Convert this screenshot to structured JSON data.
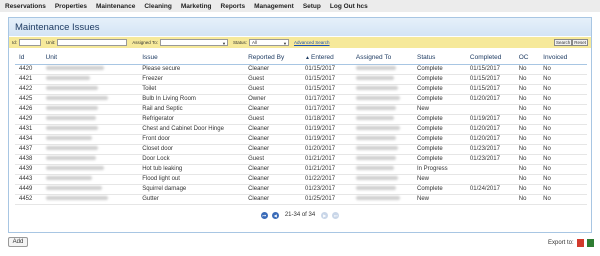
{
  "nav": [
    "Reservations",
    "Properties",
    "Maintenance",
    "Cleaning",
    "Marketing",
    "Reports",
    "Management",
    "Setup",
    "Log Out hcs"
  ],
  "panel": {
    "title": "Maintenance Issues"
  },
  "filters": {
    "id_label": "Id:",
    "unit_label": "Unit:",
    "assigned_label": "Assigned To:",
    "status_label": "Status:",
    "status_value": "All",
    "advanced_link": "Advanced Search",
    "search_btn": "Search",
    "reset_btn": "Reset"
  },
  "table": {
    "headers": [
      "Id",
      "Unit",
      "Issue",
      "Reported By",
      "Entered",
      "Assigned To",
      "Status",
      "Completed",
      "OC",
      "Invoiced"
    ],
    "rows": [
      {
        "id": "4420",
        "issue": "Please secure",
        "reported": "Cleaner",
        "entered": "01/15/2017",
        "status": "Complete",
        "completed": "01/15/2017",
        "oc": "No",
        "inv": "No"
      },
      {
        "id": "4421",
        "issue": "Freezer",
        "reported": "Guest",
        "entered": "01/15/2017",
        "status": "Complete",
        "completed": "01/15/2017",
        "oc": "No",
        "inv": "No"
      },
      {
        "id": "4422",
        "issue": "Toilet",
        "reported": "Guest",
        "entered": "01/15/2017",
        "status": "Complete",
        "completed": "01/15/2017",
        "oc": "No",
        "inv": "No"
      },
      {
        "id": "4425",
        "issue": "Bulb In Living Room",
        "reported": "Owner",
        "entered": "01/17/2017",
        "status": "Complete",
        "completed": "01/20/2017",
        "oc": "No",
        "inv": "No"
      },
      {
        "id": "4426",
        "issue": "Rail and Septic",
        "reported": "Cleaner",
        "entered": "01/17/2017",
        "status": "New",
        "completed": "",
        "oc": "No",
        "inv": "No"
      },
      {
        "id": "4429",
        "issue": "Refrigerator",
        "reported": "Guest",
        "entered": "01/18/2017",
        "status": "Complete",
        "completed": "01/19/2017",
        "oc": "No",
        "inv": "No"
      },
      {
        "id": "4431",
        "issue": "Chest and Cabinet Door Hinge",
        "reported": "Cleaner",
        "entered": "01/19/2017",
        "status": "Complete",
        "completed": "01/20/2017",
        "oc": "No",
        "inv": "No"
      },
      {
        "id": "4434",
        "issue": "Front door",
        "reported": "Cleaner",
        "entered": "01/19/2017",
        "status": "Complete",
        "completed": "01/20/2017",
        "oc": "No",
        "inv": "No"
      },
      {
        "id": "4437",
        "issue": "Closet door",
        "reported": "Cleaner",
        "entered": "01/20/2017",
        "status": "Complete",
        "completed": "01/23/2017",
        "oc": "No",
        "inv": "No"
      },
      {
        "id": "4438",
        "issue": "Door Lock",
        "reported": "Guest",
        "entered": "01/21/2017",
        "status": "Complete",
        "completed": "01/23/2017",
        "oc": "No",
        "inv": "No"
      },
      {
        "id": "4439",
        "issue": "Hot tub leaking",
        "reported": "Cleaner",
        "entered": "01/21/2017",
        "status": "In Progress",
        "completed": "",
        "oc": "No",
        "inv": "No"
      },
      {
        "id": "4443",
        "issue": "Flood light out",
        "reported": "Cleaner",
        "entered": "01/22/2017",
        "status": "New",
        "completed": "",
        "oc": "No",
        "inv": "No"
      },
      {
        "id": "4449",
        "issue": "Squirrel damage",
        "reported": "Cleaner",
        "entered": "01/23/2017",
        "status": "Complete",
        "completed": "01/24/2017",
        "oc": "No",
        "inv": "No"
      },
      {
        "id": "4452",
        "issue": "Gutter",
        "reported": "Cleaner",
        "entered": "01/25/2017",
        "status": "New",
        "completed": "",
        "oc": "No",
        "inv": "No"
      }
    ]
  },
  "pager": {
    "text": "21-34 of 34"
  },
  "footer": {
    "add_label": "Add",
    "export_label": "Export to:"
  }
}
